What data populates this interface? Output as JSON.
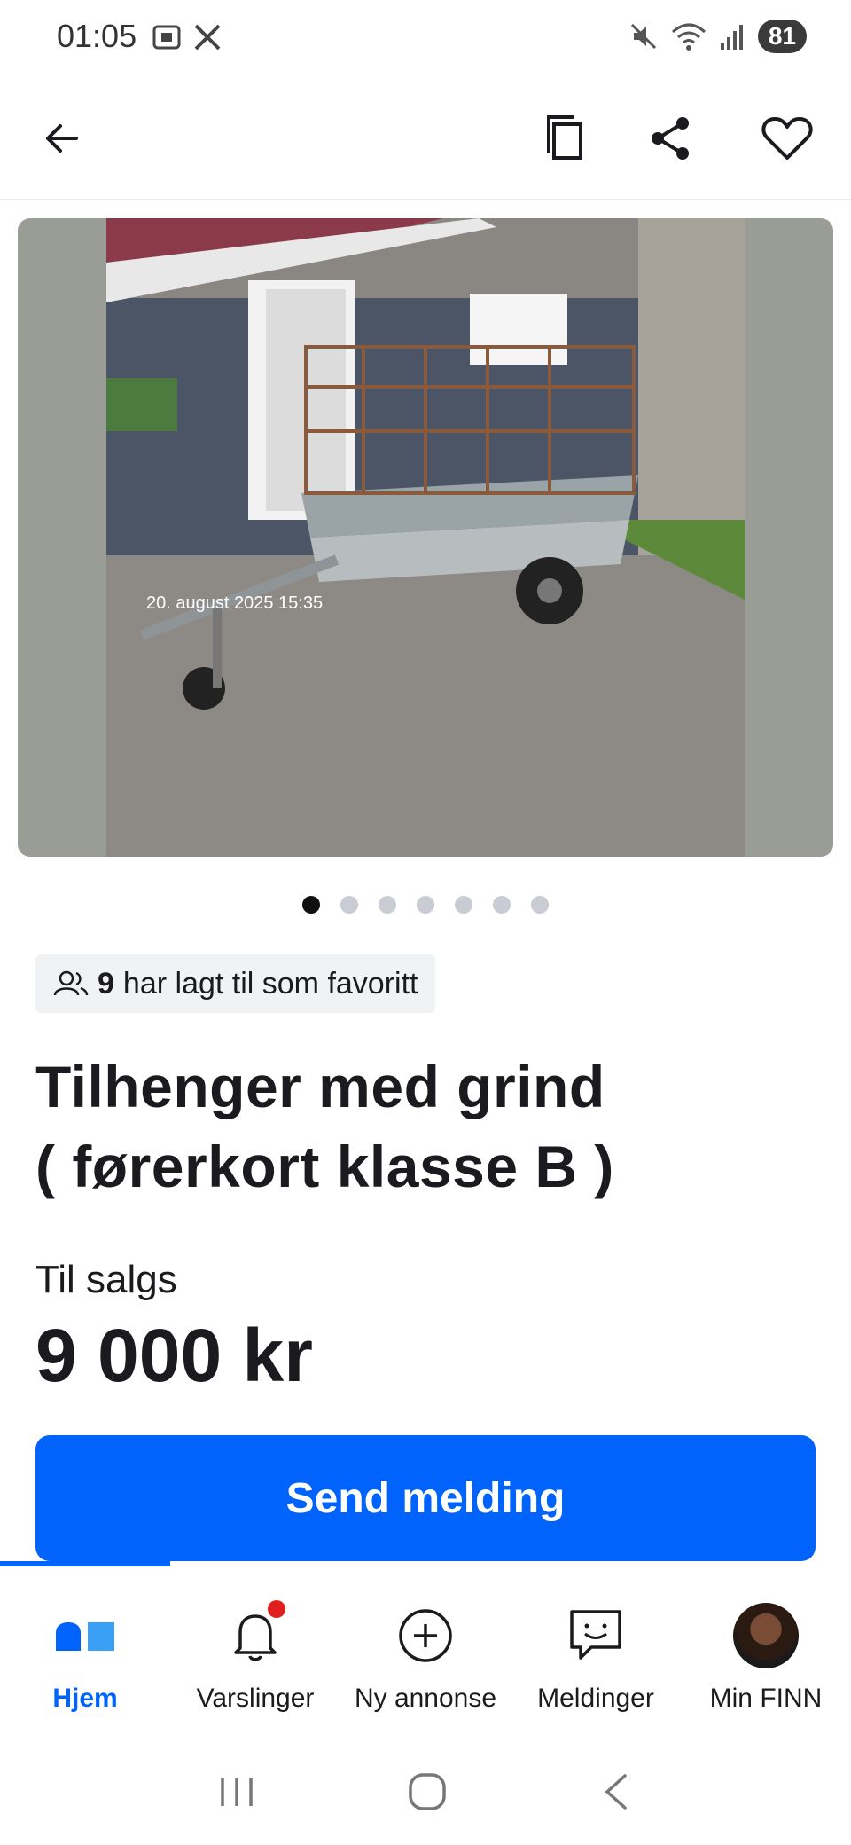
{
  "status": {
    "time": "01:05",
    "battery": "81"
  },
  "listing": {
    "photo_date": "20. august 2025 15:35",
    "image_count": 7,
    "active_image": 1,
    "favorites_count": "9",
    "favorites_text": "har lagt til som favoritt",
    "title_line1": "Tilhenger med grind",
    "title_line2": "( førerkort klasse B )",
    "sale_label": "Til salgs",
    "price": "9 000 kr"
  },
  "actions": {
    "send_label": "Send melding"
  },
  "nav": {
    "items": [
      {
        "label": "Hjem",
        "icon": "home-icon"
      },
      {
        "label": "Varslinger",
        "icon": "bell-icon"
      },
      {
        "label": "Ny annonse",
        "icon": "plus-circle-icon"
      },
      {
        "label": "Meldinger",
        "icon": "chat-icon"
      },
      {
        "label": "Min FINN",
        "icon": "avatar"
      }
    ]
  },
  "colors": {
    "accent": "#0063fb",
    "badge": "#e0201f"
  }
}
